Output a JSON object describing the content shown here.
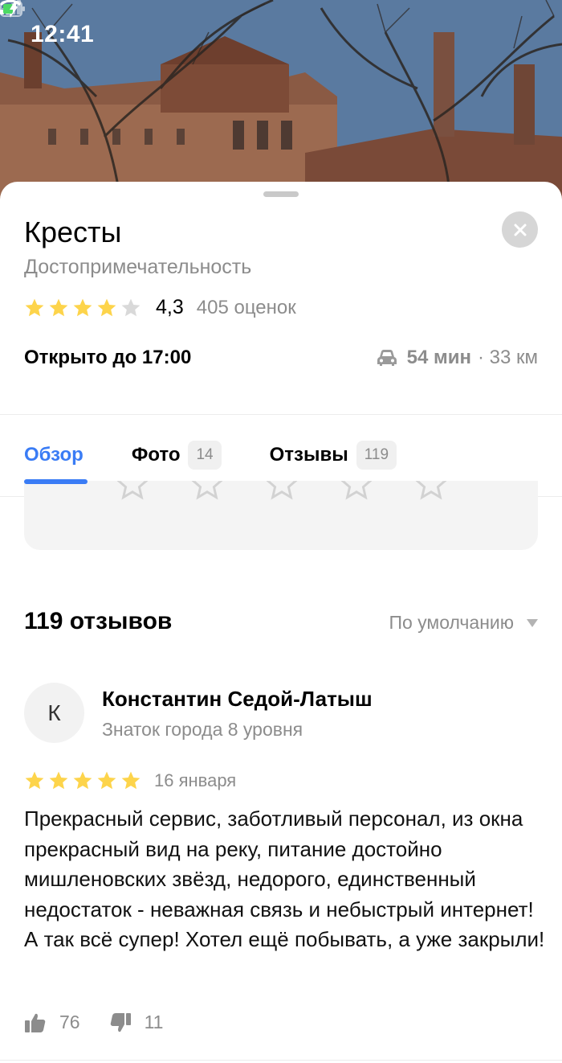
{
  "status_bar": {
    "time": "12:41"
  },
  "place": {
    "title": "Кресты",
    "category": "Достопримечательность",
    "rating": "4,3",
    "rating_stars": 4,
    "rating_count": "405 оценок",
    "hours": "Открыто до 17:00",
    "route_time": "54 мин",
    "route_distance": "· 33 км"
  },
  "tabs": [
    {
      "label": "Обзор",
      "badge": ""
    },
    {
      "label": "Фото",
      "badge": "14"
    },
    {
      "label": "Отзывы",
      "badge": "119"
    }
  ],
  "reviews": {
    "count_label": "119 отзывов",
    "sort_label": "По умолчанию",
    "items": [
      {
        "avatar_letter": "К",
        "author": "Константин Седой-Латыш",
        "level": "Знаток города 8 уровня",
        "stars": 5,
        "date": "16 января",
        "text": "Прекрасный сервис, заботливый персонал, из окна прекрасный вид на реку, питание достойно мишленовских звёзд, недорого, единственный недостаток - неважная связь и небыстрый интернет! А так всё супер! Хотел ещё побывать, а уже закрыли!",
        "likes": "76",
        "dislikes": "11"
      }
    ]
  },
  "colors": {
    "accent": "#3a7cf5",
    "star": "#fdd44b",
    "star_empty": "#d9d9d9",
    "muted": "#8c8c8c"
  },
  "icons": [
    "location-arrow-icon",
    "signal-icon",
    "wifi-icon",
    "battery-charging-icon",
    "close-icon",
    "star-icon",
    "car-icon",
    "caret-down-icon",
    "thumbs-up-icon",
    "thumbs-down-icon"
  ]
}
